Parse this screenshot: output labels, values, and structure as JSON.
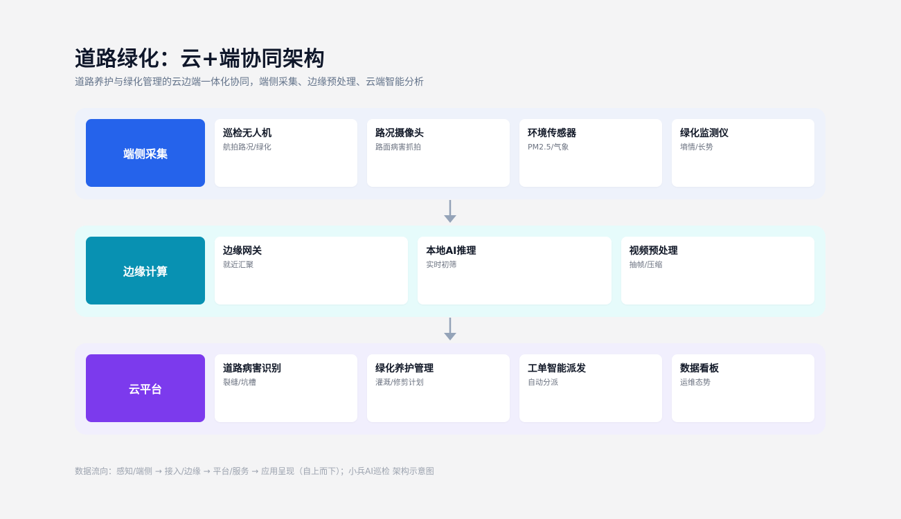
{
  "header": {
    "title": "道路绿化：云+端协同架构",
    "subtitle": "道路养护与绿化管理的云边端一体化协同，端侧采集、边缘预处理、云端智能分析"
  },
  "layers": [
    {
      "label": "端侧采集",
      "color": "#2563eb",
      "cards": [
        {
          "title": "巡检无人机",
          "desc": "航拍路况/绿化"
        },
        {
          "title": "路况摄像头",
          "desc": "路面病害抓拍"
        },
        {
          "title": "环境传感器",
          "desc": "PM2.5/气象"
        },
        {
          "title": "绿化监测仪",
          "desc": "墒情/长势"
        }
      ]
    },
    {
      "label": "边缘计算",
      "color": "#0891b2",
      "cards": [
        {
          "title": "边缘网关",
          "desc": "就近汇聚"
        },
        {
          "title": "本地AI推理",
          "desc": "实时初筛"
        },
        {
          "title": "视频预处理",
          "desc": "抽帧/压缩"
        }
      ]
    },
    {
      "label": "云平台",
      "color": "#7c3aed",
      "cards": [
        {
          "title": "道路病害识别",
          "desc": "裂缝/坑槽"
        },
        {
          "title": "绿化养护管理",
          "desc": "灌溉/修剪计划"
        },
        {
          "title": "工单智能派发",
          "desc": "自动分派"
        },
        {
          "title": "数据看板",
          "desc": "运维态势"
        }
      ]
    }
  ],
  "footer": {
    "text": "数据流向：感知/端侧 → 接入/边缘 → 平台/服务 → 应用呈现（自上而下）；小兵AI巡检 架构示意图"
  }
}
